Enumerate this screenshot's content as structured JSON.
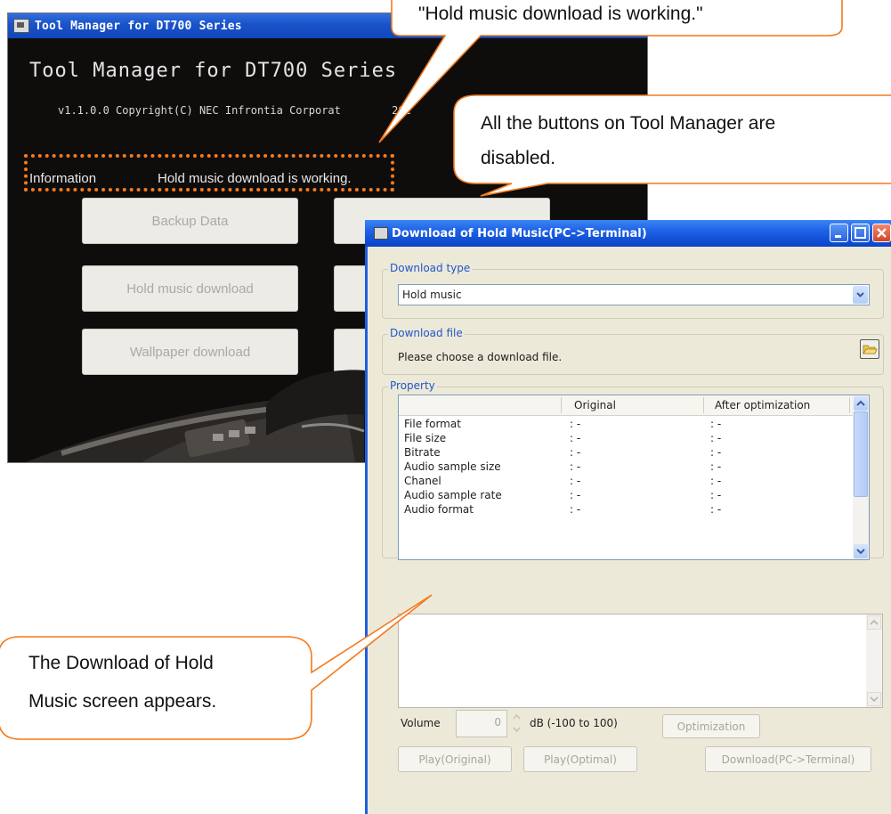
{
  "tool_manager": {
    "window_title": "Tool Manager for DT700 Series",
    "heading": "Tool Manager for DT700 Series",
    "copyright": "v1.1.0.0 Copyright(C) NEC Infrontia Corporat",
    "copyright_tail": "20C",
    "info_label": "Information",
    "info_text": "Hold music download is working.",
    "buttons": {
      "backup": "Backup Data",
      "hold_music": "Hold music download",
      "wallpaper": "Wallpaper download"
    }
  },
  "download_window": {
    "title": "Download of Hold Music(PC->Terminal)",
    "download_type_label": "Download type",
    "download_type_value": "Hold music",
    "download_file_label": "Download file",
    "download_file_prompt": "Please choose a download file.",
    "property_label": "Property",
    "columns": [
      "",
      "Original",
      "After optimization"
    ],
    "rows": [
      {
        "name": "File format",
        "original": ": -",
        "optimized": ": -"
      },
      {
        "name": "File size",
        "original": ": -",
        "optimized": ": -"
      },
      {
        "name": "Bitrate",
        "original": ": -",
        "optimized": ": -"
      },
      {
        "name": "Audio sample size",
        "original": ": -",
        "optimized": ": -"
      },
      {
        "name": "Chanel",
        "original": ": -",
        "optimized": ": -"
      },
      {
        "name": "Audio sample rate",
        "original": ": -",
        "optimized": ": -"
      },
      {
        "name": "Audio format",
        "original": ": -",
        "optimized": ": -"
      }
    ],
    "volume_label": "Volume",
    "volume_value": "0",
    "volume_unit": "dB (-100 to 100)",
    "buttons": {
      "optimization": "Optimization",
      "play_original": "Play(Original)",
      "play_optimal": "Play(Optimal)",
      "download": "Download(PC->Terminal)"
    }
  },
  "callouts": {
    "top": "\"Hold music download is working.\"",
    "right_line1": "All the buttons on Tool Manager are",
    "right_line2": "disabled.",
    "left_line1": "The Download of Hold",
    "left_line2": "Music screen appears."
  },
  "colors": {
    "callout_border": "#f47a1c",
    "titlebar_blue": "#1f61e6",
    "dialog_bg": "#ece9d8",
    "group_label": "#2255cc"
  }
}
